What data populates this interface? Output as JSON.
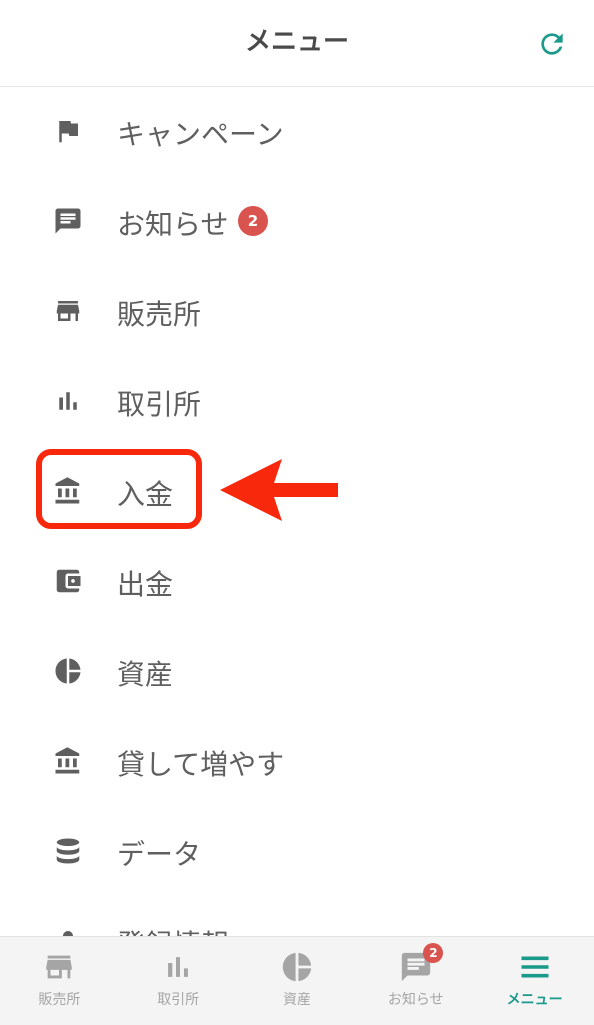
{
  "header": {
    "title": "メニュー",
    "refresh_icon": "refresh-icon"
  },
  "menu": {
    "items": [
      {
        "label": "キャンペーン",
        "icon": "flag-icon"
      },
      {
        "label": "お知らせ",
        "icon": "message-icon",
        "badge": "2"
      },
      {
        "label": "販売所",
        "icon": "store-icon"
      },
      {
        "label": "取引所",
        "icon": "bar-chart-icon"
      },
      {
        "label": "入金",
        "icon": "bank-icon"
      },
      {
        "label": "出金",
        "icon": "wallet-icon"
      },
      {
        "label": "資産",
        "icon": "pie-chart-icon"
      },
      {
        "label": "貸して増やす",
        "icon": "bank-icon"
      },
      {
        "label": "データ",
        "icon": "database-icon"
      },
      {
        "label": "登録情報",
        "icon": "user-icon"
      }
    ]
  },
  "bottom_nav": {
    "tabs": [
      {
        "label": "販売所",
        "icon": "store-icon"
      },
      {
        "label": "取引所",
        "icon": "bar-chart-icon"
      },
      {
        "label": "資産",
        "icon": "pie-chart-icon"
      },
      {
        "label": "お知らせ",
        "icon": "message-icon",
        "badge": "2"
      },
      {
        "label": "メニュー",
        "icon": "hamburger-icon",
        "active": true
      }
    ]
  },
  "colors": {
    "accent": "#1a9a8a",
    "highlight": "#f8280c",
    "badge": "#d9534f",
    "icon": "#5f5f5f",
    "nav_inactive": "#a5a5a5"
  }
}
